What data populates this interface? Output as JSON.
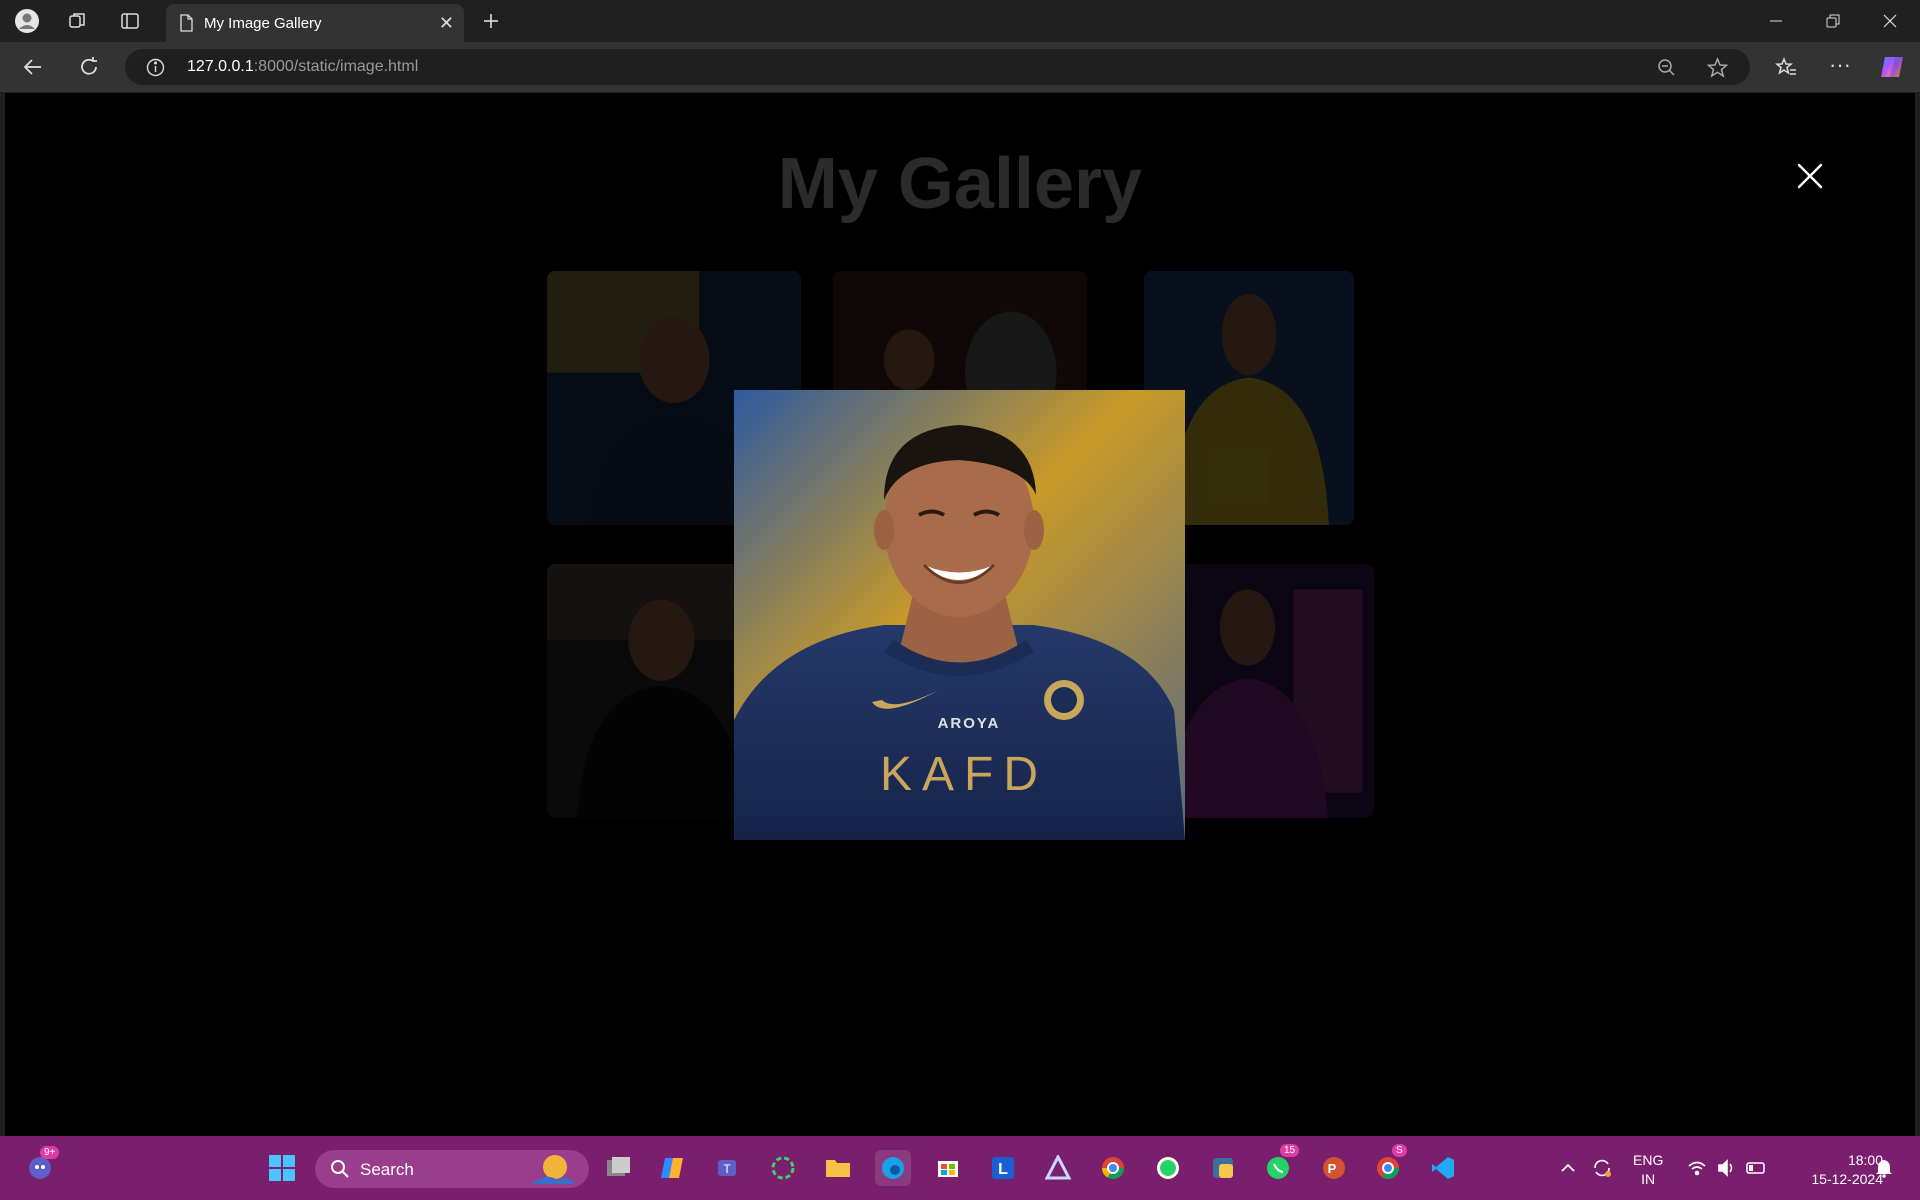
{
  "browser": {
    "tab_title": "My Image Gallery",
    "url_host": "127.0.0.1",
    "url_rest": ":8000/static/image.html"
  },
  "page": {
    "title": "My Gallery",
    "close_symbol": "✕"
  },
  "gallery": {
    "thumbnails": [
      {
        "name": "thumb-1",
        "colors": [
          "#1e3a66",
          "#c8a23c",
          "#1f2d58"
        ]
      },
      {
        "name": "thumb-2",
        "colors": [
          "#4a2620",
          "#b82a2a",
          "#6f6f6f"
        ]
      },
      {
        "name": "thumb-3",
        "colors": [
          "#2b4a86",
          "#e6c52a",
          "#f0d232"
        ]
      },
      {
        "name": "thumb-4",
        "colors": [
          "#2a2a2a",
          "#5a5046",
          "#111111"
        ]
      },
      {
        "name": "thumb-5",
        "colors": [
          "#3a1d5a",
          "#9b2aa0",
          "#d14aa6"
        ]
      }
    ]
  },
  "modal": {
    "jersey_sponsor": "KAFD",
    "jersey_brand": "AROYA",
    "colors": {
      "background_top": "#2d5aa0",
      "background_mid": "#c89a28",
      "jersey": "#1c2d55",
      "skin": "#a86c4a",
      "hair": "#1a1410",
      "gold": "#c9a65a"
    }
  },
  "taskbar": {
    "search_label": "Search",
    "chat_badge": "9+",
    "whatsapp_badge": "15",
    "chrome_badge": "S",
    "lang_line1": "ENG",
    "lang_line2": "IN",
    "time": "18:00",
    "date": "15-12-2024",
    "accent": "#7a1f6e"
  }
}
